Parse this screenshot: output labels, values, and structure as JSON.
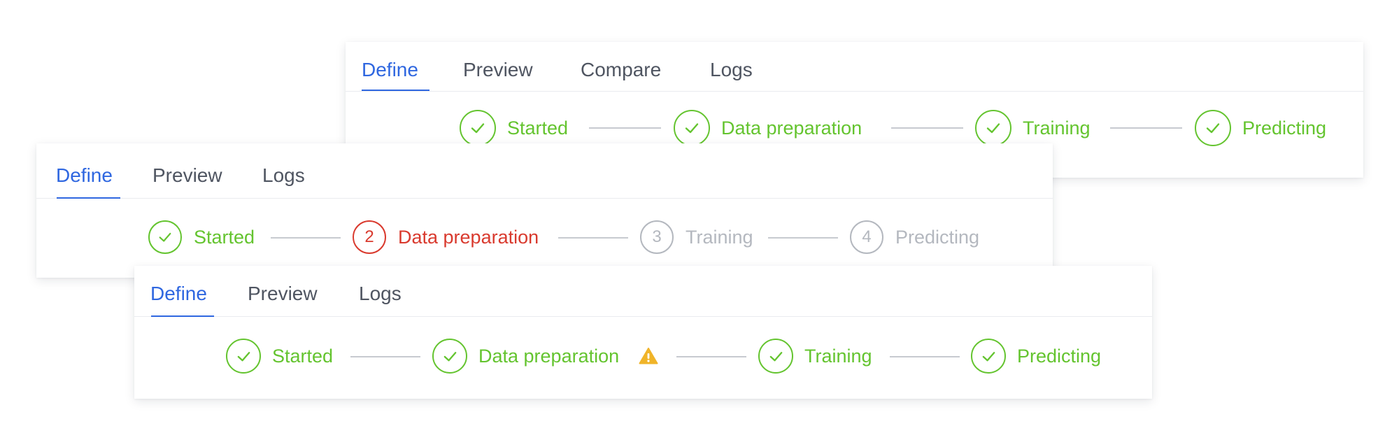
{
  "colors": {
    "accent": "#2f67e0",
    "complete": "#64c42f",
    "error": "#d93a2e",
    "pending": "#b4b8bf",
    "warning": "#f0b429",
    "connector": "#c7cad0",
    "tab_text": "#4f5561"
  },
  "panel_a": {
    "tabs": [
      {
        "label": "Define",
        "active": true
      },
      {
        "label": "Preview",
        "active": false
      },
      {
        "label": "Compare",
        "active": false
      },
      {
        "label": "Logs",
        "active": false
      }
    ],
    "steps": [
      {
        "label": "Started",
        "status": "complete",
        "icon": "check-icon"
      },
      {
        "label": "Data preparation",
        "status": "complete",
        "icon": "check-icon"
      },
      {
        "label": "Training",
        "status": "complete",
        "icon": "check-icon"
      },
      {
        "label": "Predicting",
        "status": "complete",
        "icon": "check-icon"
      }
    ]
  },
  "panel_b": {
    "tabs": [
      {
        "label": "Define",
        "active": true
      },
      {
        "label": "Preview",
        "active": false
      },
      {
        "label": "Logs",
        "active": false
      }
    ],
    "steps": [
      {
        "label": "Started",
        "status": "complete",
        "icon": "check-icon"
      },
      {
        "number": "2",
        "label": "Data preparation",
        "status": "error"
      },
      {
        "number": "3",
        "label": "Training",
        "status": "pending"
      },
      {
        "number": "4",
        "label": "Predicting",
        "status": "pending"
      }
    ]
  },
  "panel_c": {
    "tabs": [
      {
        "label": "Define",
        "active": true
      },
      {
        "label": "Preview",
        "active": false
      },
      {
        "label": "Logs",
        "active": false
      }
    ],
    "steps": [
      {
        "label": "Started",
        "status": "complete",
        "icon": "check-icon"
      },
      {
        "label": "Data preparation",
        "status": "complete",
        "icon": "check-icon",
        "warning_icon": "warning-icon"
      },
      {
        "label": "Training",
        "status": "complete",
        "icon": "check-icon"
      },
      {
        "label": "Predicting",
        "status": "complete",
        "icon": "check-icon"
      }
    ]
  }
}
